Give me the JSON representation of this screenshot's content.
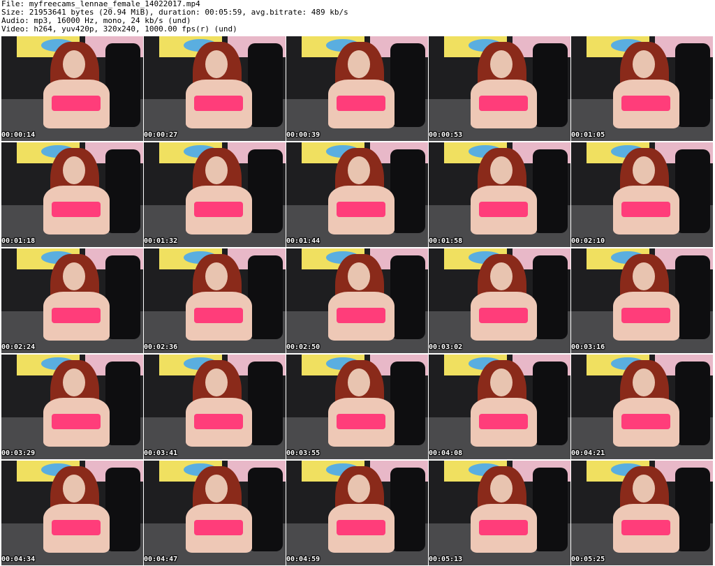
{
  "header": {
    "file_line": "File: myfreecams_lennae_female_14022017.mp4",
    "size_line": "Size: 21953641 bytes (20.94 MiB), duration: 00:05:59, avg.bitrate: 489 kb/s",
    "audio_line": "Audio: mp3, 16000 Hz, mono, 24 kb/s (und)",
    "video_line": "Video: h264, yuv420p, 320x240, 1000.00 fps(r) (und)"
  },
  "thumbnails": [
    {
      "timestamp": "00:00:14"
    },
    {
      "timestamp": "00:00:27"
    },
    {
      "timestamp": "00:00:39"
    },
    {
      "timestamp": "00:00:53"
    },
    {
      "timestamp": "00:01:05"
    },
    {
      "timestamp": "00:01:18"
    },
    {
      "timestamp": "00:01:32"
    },
    {
      "timestamp": "00:01:44"
    },
    {
      "timestamp": "00:01:58"
    },
    {
      "timestamp": "00:02:10"
    },
    {
      "timestamp": "00:02:24"
    },
    {
      "timestamp": "00:02:36"
    },
    {
      "timestamp": "00:02:50"
    },
    {
      "timestamp": "00:03:02"
    },
    {
      "timestamp": "00:03:16"
    },
    {
      "timestamp": "00:03:29"
    },
    {
      "timestamp": "00:03:41"
    },
    {
      "timestamp": "00:03:55"
    },
    {
      "timestamp": "00:04:08"
    },
    {
      "timestamp": "00:04:21"
    },
    {
      "timestamp": "00:04:34"
    },
    {
      "timestamp": "00:04:47"
    },
    {
      "timestamp": "00:04:59"
    },
    {
      "timestamp": "00:05:13"
    },
    {
      "timestamp": "00:05:25"
    }
  ]
}
